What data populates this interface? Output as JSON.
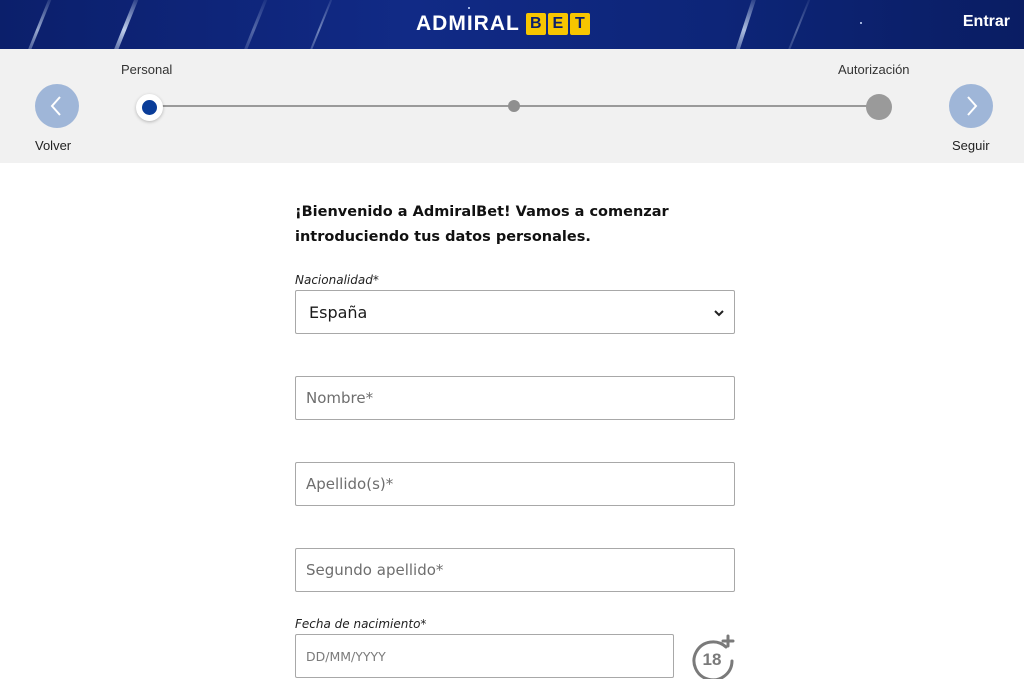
{
  "header": {
    "logo_word": "ADMIRAL",
    "logo_bet_letters": [
      "B",
      "E",
      "T"
    ],
    "login_label": "Entrar"
  },
  "stepper": {
    "back_label": "Volver",
    "next_label": "Seguir",
    "first_step_label": "Personal",
    "last_step_label": "Autorización",
    "current_step": 1,
    "total_steps": 3
  },
  "form": {
    "intro_line1": "¡Bienvenido a AdmiralBet! Vamos a comenzar",
    "intro_line2": "introduciendo tus datos personales.",
    "nationality_label": "Nacionalidad*",
    "nationality_value": "España",
    "first_name_placeholder": "Nombre*",
    "last_name_placeholder": "Apellido(s)*",
    "second_last_name_placeholder": "Segundo apellido*",
    "birthdate_label": "Fecha de nacimiento*",
    "birthdate_placeholder": "DD/MM/YYYY",
    "age_badge": "18"
  },
  "colors": {
    "header_bg": "#112a86",
    "logo_bet_yellow": "#f7c600",
    "step_active": "#0a3d99",
    "nav_circle": "#9fb6d8"
  }
}
